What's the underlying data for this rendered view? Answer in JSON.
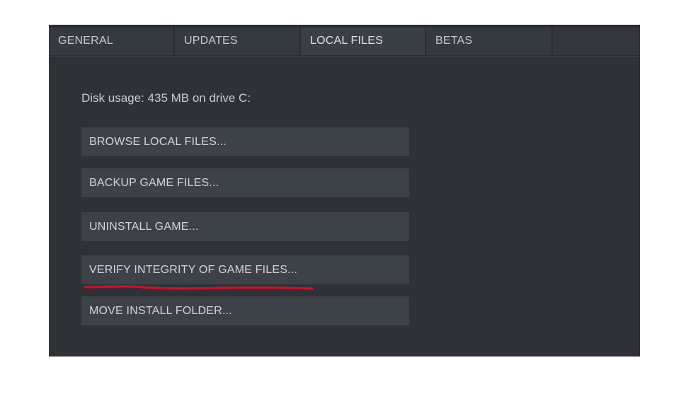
{
  "tabs": [
    {
      "label": "GENERAL",
      "active": false
    },
    {
      "label": "UPDATES",
      "active": false
    },
    {
      "label": "LOCAL FILES",
      "active": true
    },
    {
      "label": "BETAS",
      "active": false
    }
  ],
  "local_files": {
    "disk_usage": "Disk usage: 435 MB on drive C:",
    "buttons": [
      {
        "label": "BROWSE LOCAL FILES..."
      },
      {
        "label": "BACKUP GAME FILES..."
      },
      {
        "label": "UNINSTALL GAME..."
      },
      {
        "label": "VERIFY INTEGRITY OF GAME FILES..."
      },
      {
        "label": "MOVE INSTALL FOLDER..."
      }
    ]
  },
  "colors": {
    "window_background": "#2e3136",
    "button_background": "#3d4148",
    "highlight_underline": "#d0102a"
  }
}
